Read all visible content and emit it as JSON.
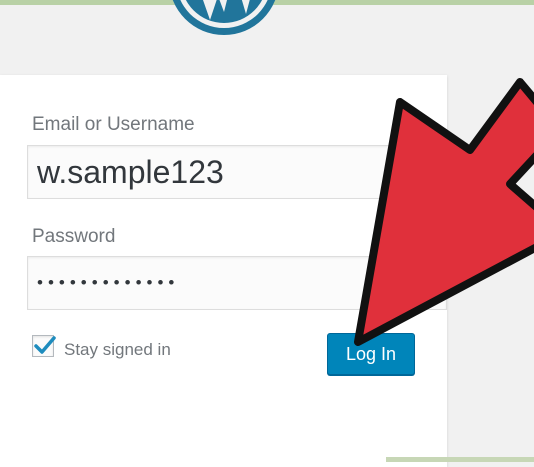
{
  "login_form": {
    "username_label": "Email or Username",
    "username_value": "w.sample123",
    "password_label": "Password",
    "password_value": "wpassword1234",
    "remember_label": "Stay signed in",
    "remember_checked": true,
    "submit_label": "Log In"
  },
  "icons": {
    "logo": "wordpress-logo-icon",
    "checkbox": "checkmark-icon",
    "annotation": "red-arrow-icon"
  },
  "colors": {
    "button": "#0085ba",
    "checkbox_check": "#1e8cbe",
    "arrow": "#e0303b",
    "logo": "#21759b",
    "background": "#f1f1f1"
  }
}
